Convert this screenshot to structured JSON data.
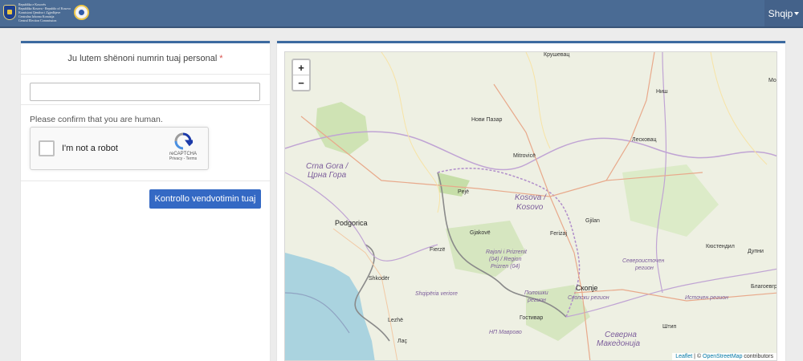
{
  "header": {
    "logo_text_lines": [
      "Republika e Kosovës",
      "Republika Kosova - Republic of Kosovo",
      "Komisioni Qendror i Zgjedhjeve",
      "Centralna Izborna Komisija",
      "Central Election Commission"
    ],
    "language_label": "Shqip"
  },
  "form": {
    "prompt": "Ju lutem shënoni numrin tuaj personal",
    "required_mark": "*",
    "personal_number_value": "",
    "captcha_prompt": "Please confirm that you are human.",
    "captcha_label": "I'm not a robot",
    "captcha_brand": "reCAPTCHA",
    "captcha_links": "Privacy - Terms",
    "submit_label": "Kontrollo vendvotimin tuaj"
  },
  "map": {
    "zoom_in": "+",
    "zoom_out": "−",
    "labels": [
      {
        "text": "Крушевац",
        "cls": "place"
      },
      {
        "text": "Ниш",
        "cls": "place"
      },
      {
        "text": "Нови Пазар",
        "cls": "place"
      },
      {
        "text": "Лесковац",
        "cls": "place"
      },
      {
        "text": "Mitrovicë",
        "cls": "place"
      },
      {
        "text": "Crna Gora /",
        "cls": "country"
      },
      {
        "text": "Црна Гора",
        "cls": "country"
      },
      {
        "text": "Pejë",
        "cls": "place"
      },
      {
        "text": "Kosova /",
        "cls": "country"
      },
      {
        "text": "Kosovo",
        "cls": "country"
      },
      {
        "text": "Gjilan",
        "cls": "place"
      },
      {
        "text": "Podgorica",
        "cls": "big"
      },
      {
        "text": "Gjakovë",
        "cls": "place"
      },
      {
        "text": "Ferizaj",
        "cls": "place"
      },
      {
        "text": "Fierzë",
        "cls": "place"
      },
      {
        "text": "Rajoni i Prizrenit",
        "cls": "region"
      },
      {
        "text": "(04) / Region",
        "cls": "region"
      },
      {
        "text": "Prizren (04)",
        "cls": "region"
      },
      {
        "text": "Кюстендил",
        "cls": "place"
      },
      {
        "text": "Североисточен",
        "cls": "region"
      },
      {
        "text": "регион",
        "cls": "region"
      },
      {
        "text": "Shkodër",
        "cls": "place"
      },
      {
        "text": "Shqipëria veriore",
        "cls": "region"
      },
      {
        "text": "Полошки",
        "cls": "region"
      },
      {
        "text": "регион",
        "cls": "region"
      },
      {
        "text": "Скопје",
        "cls": "big"
      },
      {
        "text": "Скопски регион",
        "cls": "region"
      },
      {
        "text": "Источен регион",
        "cls": "region"
      },
      {
        "text": "Благоевгр",
        "cls": "place"
      },
      {
        "text": "Дупни",
        "cls": "place"
      },
      {
        "text": "Lezhë",
        "cls": "place"
      },
      {
        "text": "Гостивар",
        "cls": "place"
      },
      {
        "text": "Штип",
        "cls": "place"
      },
      {
        "text": "НП Маврово",
        "cls": "region"
      },
      {
        "text": "Лаç",
        "cls": "place"
      },
      {
        "text": "Северна",
        "cls": "country"
      },
      {
        "text": "Македонија",
        "cls": "country"
      },
      {
        "text": "Мо",
        "cls": "place"
      }
    ],
    "attribution_leaflet": "Leaflet",
    "attribution_sep": " | © ",
    "attribution_osm": "OpenStreetMap",
    "attribution_suffix": " contributors"
  }
}
